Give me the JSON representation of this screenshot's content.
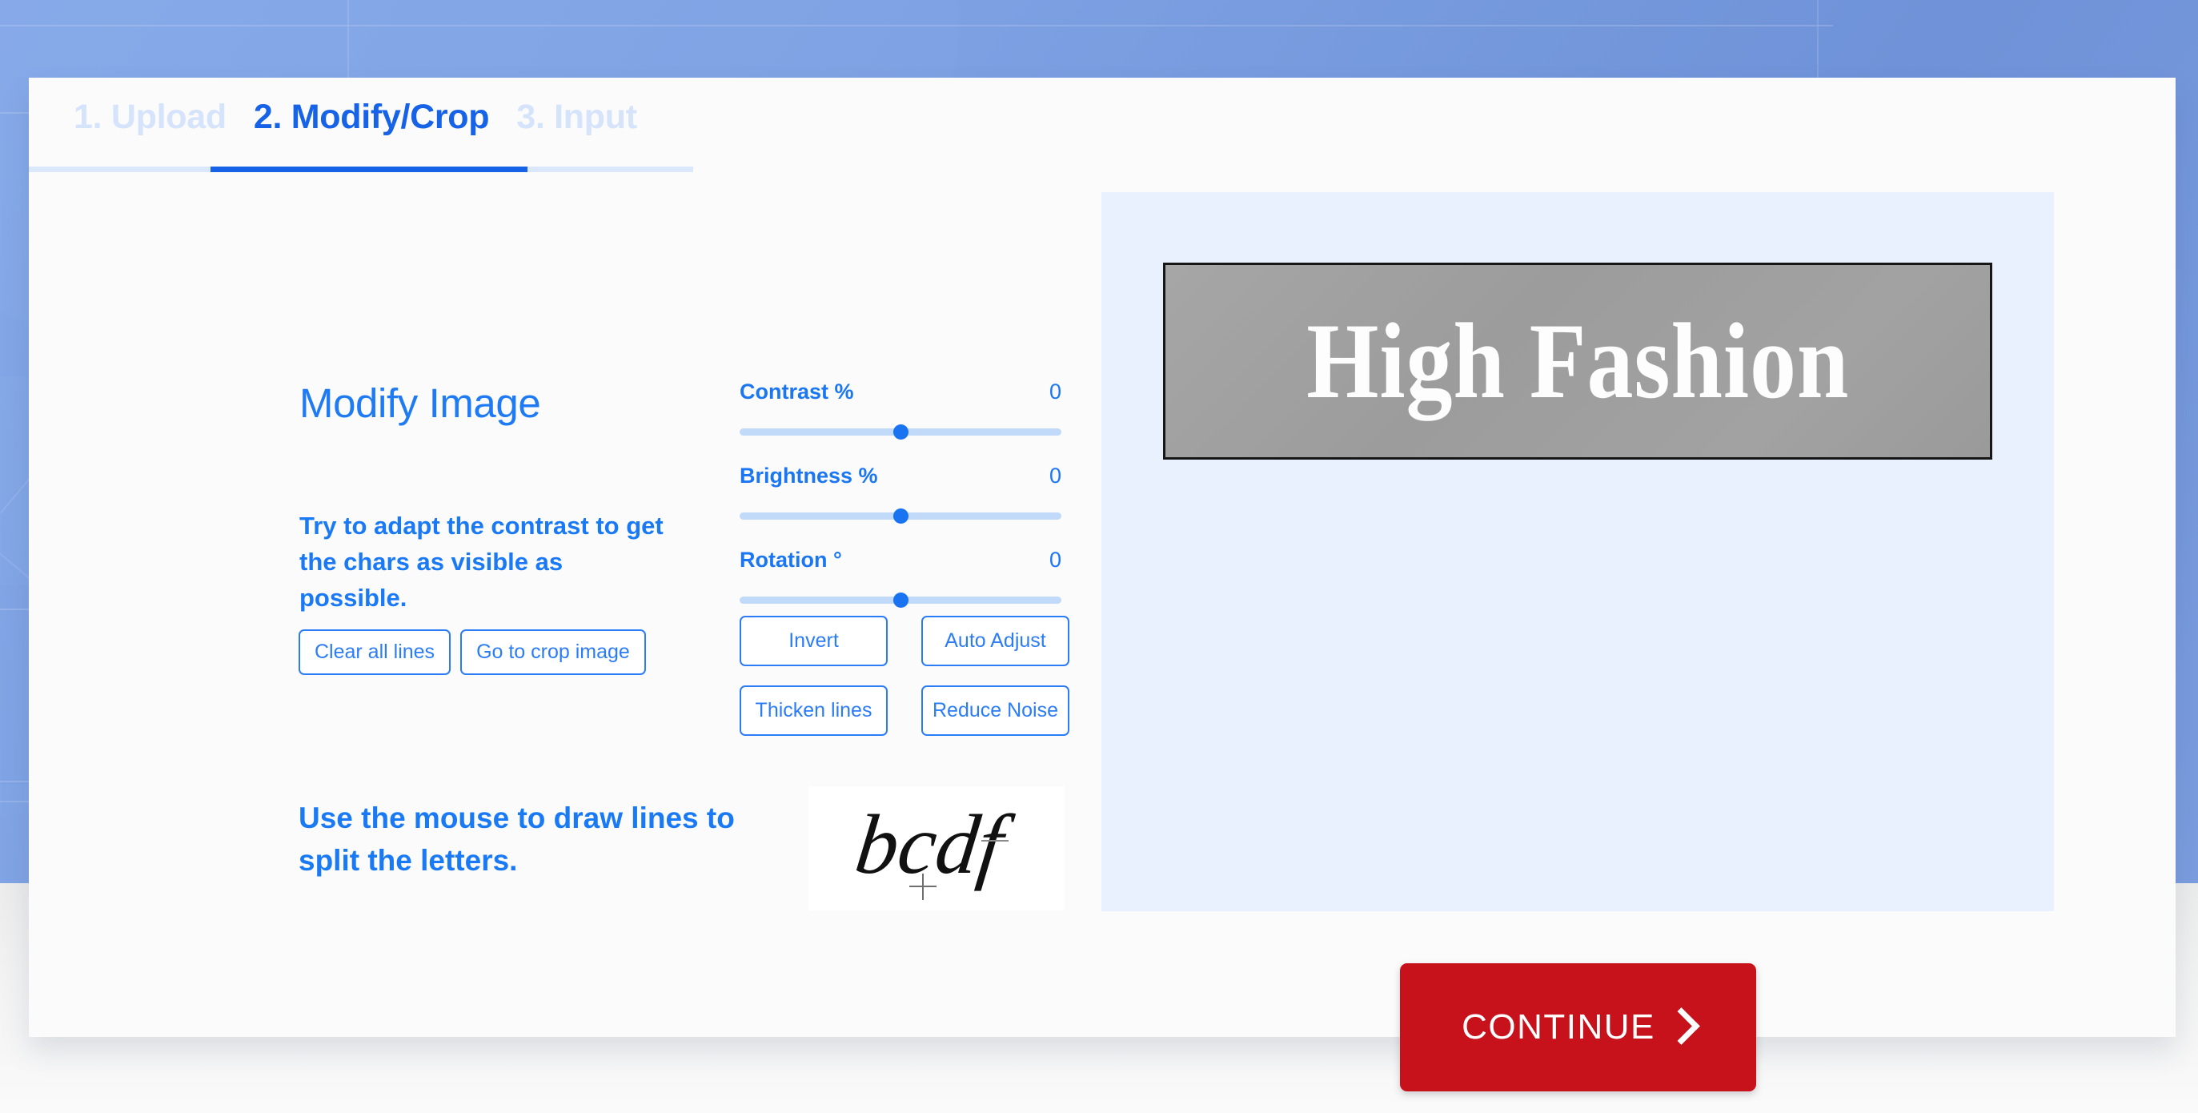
{
  "app": {
    "background_color": "#7b9ddf",
    "card_color": "#fbfbfb",
    "accent_color": "#1663e8",
    "continue_color": "#c8121b"
  },
  "steps": {
    "tabs": [
      {
        "label": "1. Upload",
        "state": "inactive"
      },
      {
        "label": "2. Modify/Crop",
        "state": "active"
      },
      {
        "label": "3. Input",
        "state": "inactive"
      }
    ]
  },
  "modify": {
    "title": "Modify Image",
    "hint": "Try to adapt the contrast to get the chars as visible as possible.",
    "buttons": [
      {
        "label": "Clear all lines",
        "name": "clear-all-lines-button"
      },
      {
        "label": "Go to crop image",
        "name": "go-to-crop-image-button"
      }
    ]
  },
  "sliders": [
    {
      "label": "Contrast %",
      "value": "0",
      "name": "contrast-slider",
      "percent": 50
    },
    {
      "label": "Brightness %",
      "value": "0",
      "name": "brightness-slider",
      "percent": 50
    },
    {
      "label": "Rotation °",
      "value": "0",
      "name": "rotation-slider",
      "percent": 50
    }
  ],
  "actions": [
    {
      "label": "Invert",
      "name": "invert-button"
    },
    {
      "label": "Auto Adjust",
      "name": "auto-adjust-button"
    },
    {
      "label": "Thicken lines",
      "name": "thicken-lines-button"
    },
    {
      "label": "Reduce Noise",
      "name": "reduce-noise-button"
    }
  ],
  "draw": {
    "hint": "Use the mouse to draw lines to split the letters.",
    "sample_text": "bcdf"
  },
  "preview": {
    "image_text": "High Fashion",
    "image_bg": "#a0a0a0",
    "image_border": "#161616"
  },
  "footer": {
    "continue_label": "CONTINUE"
  }
}
